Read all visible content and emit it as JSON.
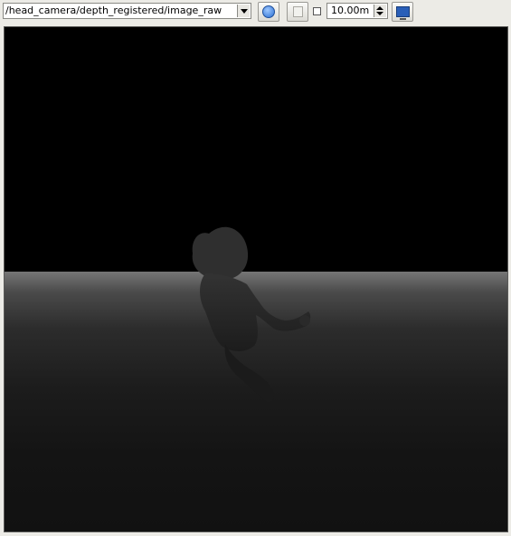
{
  "toolbar": {
    "topic_value": "/head_camera/depth_registered/image_raw",
    "zoom_value": "10.00m",
    "smooth_checked": false
  },
  "icons": {
    "combo_arrow": "chevron-down-icon",
    "refresh": "refresh-icon",
    "save": "save-icon",
    "fit": "monitor-icon"
  },
  "colors": {
    "window_bg": "#ecebe6",
    "image_bg": "#000000",
    "floor_top": "#767676",
    "floor_bottom": "#111111"
  }
}
